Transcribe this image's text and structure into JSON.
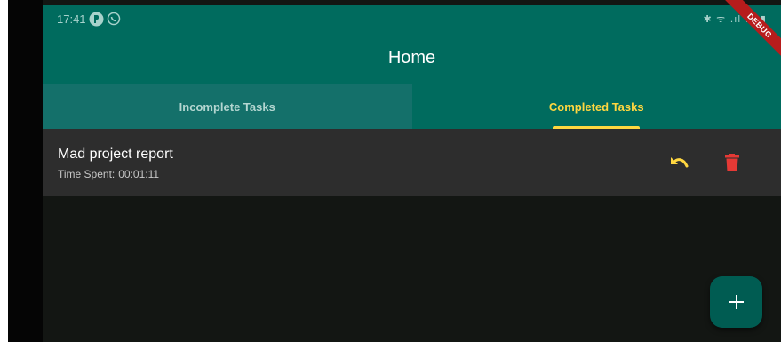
{
  "status_bar": {
    "time": "17:41",
    "right_indicators": "✱ ᯤ .ıl .ıl ▮"
  },
  "app_bar": {
    "title": "Home"
  },
  "debug_banner": {
    "label": "DEBUG"
  },
  "tabs": [
    {
      "label": "Incomplete Tasks",
      "selected": false
    },
    {
      "label": "Completed Tasks",
      "selected": true
    }
  ],
  "tasks": [
    {
      "title": "Mad project report",
      "time_spent_label": "Time Spent:",
      "time_spent": "00:01:11"
    }
  ],
  "actions": {
    "undo_icon": "undo-icon",
    "delete_icon": "trash-icon",
    "fab_icon": "plus-icon"
  },
  "colors": {
    "primary": "#006b5e",
    "accent": "#ffd740",
    "delete": "#e53935",
    "background": "#131613",
    "card": "#2d2d2d"
  }
}
